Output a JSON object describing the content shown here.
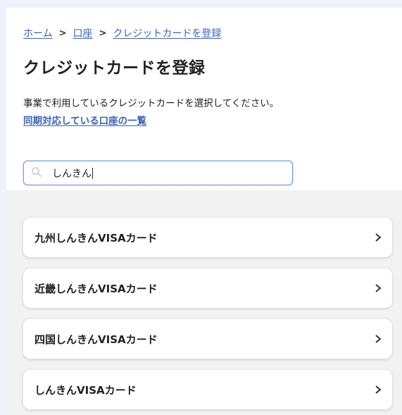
{
  "breadcrumb": {
    "items": [
      "ホーム",
      "口座",
      "クレジットカードを登録"
    ]
  },
  "page": {
    "title": "クレジットカードを登録",
    "description": "事業で利用しているクレジットカードを選択してください。",
    "link": "同期対応している口座の一覧"
  },
  "search": {
    "value": "しんきん",
    "icon": "search-icon"
  },
  "results": [
    {
      "label": "九州しんきんVISAカード"
    },
    {
      "label": "近畿しんきんVISAカード"
    },
    {
      "label": "四国しんきんVISAカード"
    },
    {
      "label": "しんきんVISAカード"
    }
  ],
  "colors": {
    "link": "#3b62b8",
    "search_border": "#6e9be0",
    "results_bg": "#f3f2f2",
    "outer_bg": "#eef3fb"
  }
}
